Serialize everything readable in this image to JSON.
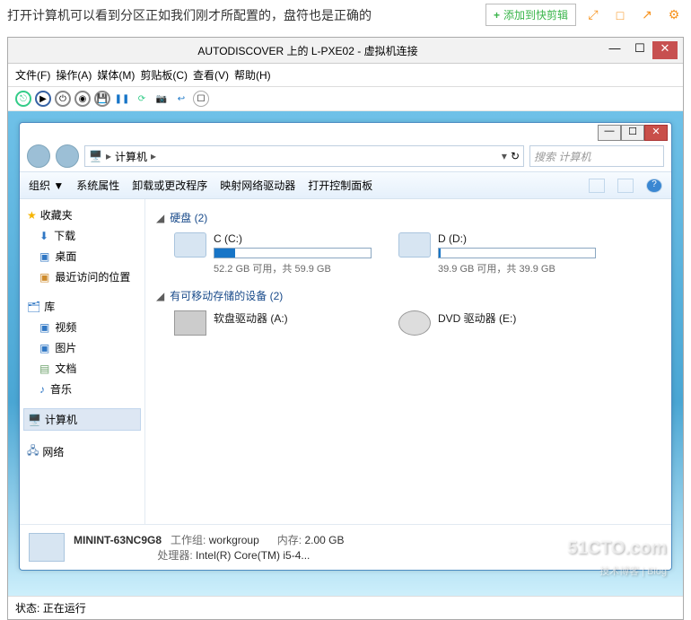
{
  "caption": "打开计算机可以看到分区正如我们刚才所配置的，盘符也是正确的",
  "clip_btn": "添加到快剪辑",
  "vm": {
    "title": "AUTODISCOVER 上的 L-PXE02 - 虚拟机连接",
    "menu": [
      "文件(F)",
      "操作(A)",
      "媒体(M)",
      "剪贴板(C)",
      "查看(V)",
      "帮助(H)"
    ]
  },
  "explorer": {
    "breadcrumb": [
      "计算机"
    ],
    "search_placeholder": "搜索 计算机",
    "cmdbar": {
      "organize": "组织 ▼",
      "properties": "系统属性",
      "uninstall": "卸载或更改程序",
      "mapnet": "映射网络驱动器",
      "cpanel": "打开控制面板"
    },
    "side": {
      "favorites": "收藏夹",
      "downloads": "下载",
      "desktop": "桌面",
      "recent": "最近访问的位置",
      "libraries": "库",
      "videos": "视频",
      "pictures": "图片",
      "documents": "文档",
      "music": "音乐",
      "computer": "计算机",
      "network": "网络"
    },
    "sections": {
      "hdd_label": "硬盘 (2)",
      "removable_label": "有可移动存储的设备 (2)"
    },
    "drives": {
      "c": {
        "name": "C (C:)",
        "free": "52.2 GB 可用，共 59.9 GB",
        "fill_pct": 13
      },
      "d": {
        "name": "D (D:)",
        "free": "39.9 GB 可用，共 39.9 GB",
        "fill_pct": 1
      },
      "a": {
        "name": "软盘驱动器 (A:)"
      },
      "e": {
        "name": "DVD 驱动器 (E:)"
      }
    },
    "footer": {
      "hostname": "MININT-63NC9G8",
      "workgroup_label": "工作组:",
      "workgroup": "workgroup",
      "mem_label": "内存:",
      "mem": "2.00 GB",
      "cpu_label": "处理器:",
      "cpu": "Intel(R) Core(TM) i5-4..."
    }
  },
  "watermark": {
    "main": "51CTO.com",
    "sub": "技术博客 | Blog"
  },
  "status": {
    "label": "状态:",
    "value": "正在运行"
  }
}
